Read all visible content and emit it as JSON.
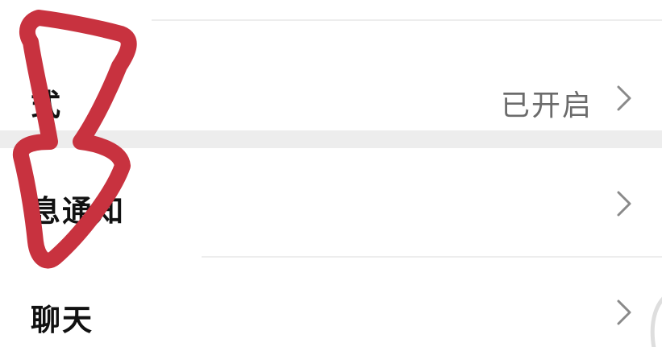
{
  "settings": {
    "rows": [
      {
        "id": "mode",
        "label": "式",
        "value": "已开启"
      },
      {
        "id": "notifications",
        "label": "息通知",
        "value": ""
      },
      {
        "id": "chat",
        "label": "聊天",
        "value": ""
      }
    ]
  },
  "annotation": {
    "arrow_color": "#c8323f"
  },
  "icons": {
    "chevron": "chevron-right-icon",
    "arrow": "down-arrow-annotation-icon"
  }
}
